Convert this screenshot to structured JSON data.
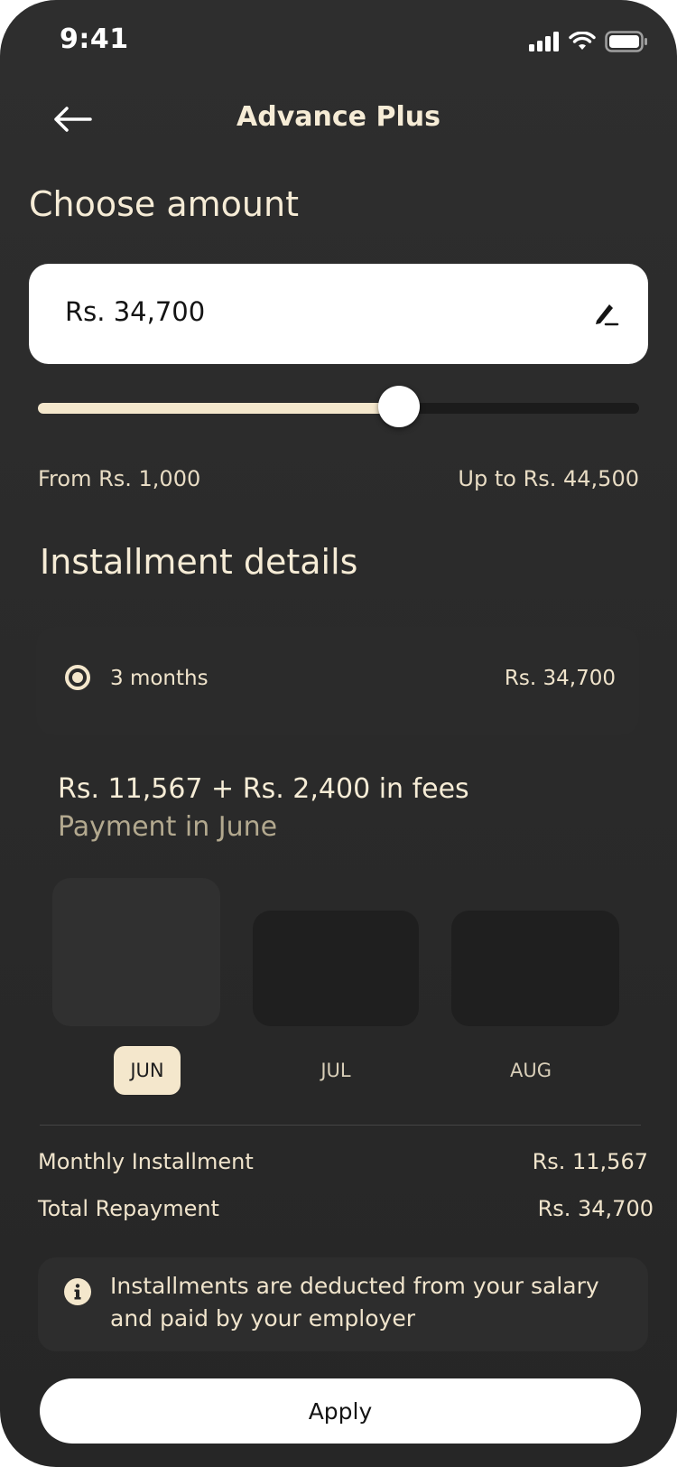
{
  "status_bar": {
    "time": "9:41"
  },
  "header": {
    "title": "Advance Plus"
  },
  "amount": {
    "heading": "Choose amount",
    "value": "Rs. 34,700",
    "slider_fraction": 0.6,
    "range_min": "From Rs. 1,000",
    "range_max": "Up to Rs. 44,500"
  },
  "installment": {
    "heading": "Installment details",
    "option": {
      "label": "3 months",
      "amount": "Rs. 34,700",
      "selected": true
    },
    "payment_line": "Rs. 11,567 + Rs. 2,400 in fees",
    "payment_sub": "Payment in June",
    "months": [
      {
        "label": "JUN",
        "active": true
      },
      {
        "label": "JUL",
        "active": false
      },
      {
        "label": "AUG",
        "active": false
      }
    ]
  },
  "summary": {
    "monthly_label": "Monthly Installment",
    "monthly_value": "Rs. 11,567",
    "total_label": "Total Repayment",
    "total_value": "Rs. 34,700"
  },
  "info": {
    "icon": "info-icon",
    "text": "Installments are deducted from your salary and paid by your employer"
  },
  "actions": {
    "apply_label": "Apply"
  },
  "colors": {
    "background": "#2a2a2a",
    "accent": "#f4e7cc",
    "card": "#2b2b2b"
  }
}
